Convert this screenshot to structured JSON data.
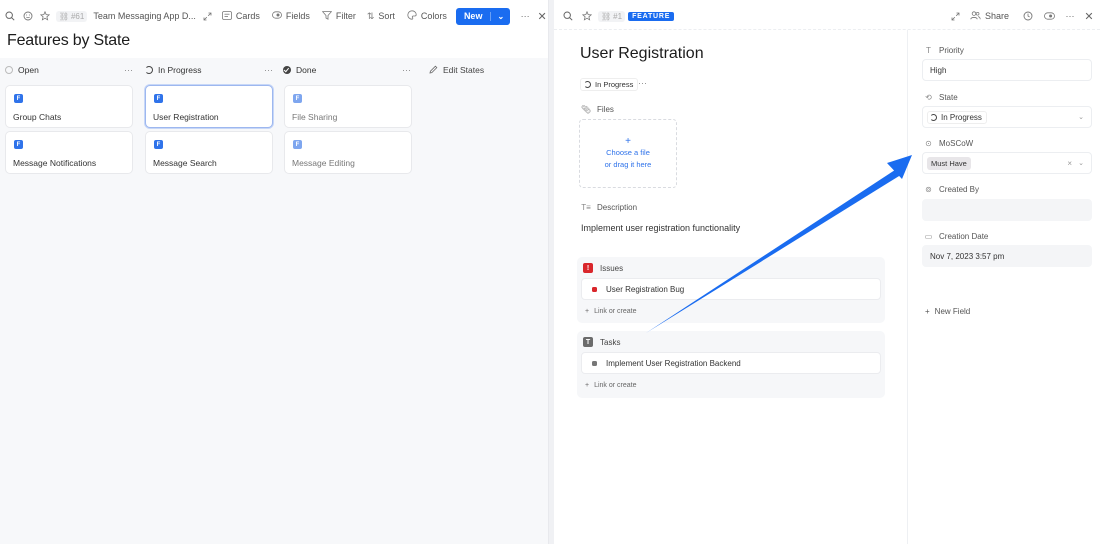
{
  "left_panel": {
    "toolbar": {
      "search_icon": "search-icon",
      "emoji_icon": "smiley-icon",
      "star_icon": "star-icon",
      "id_label": "#61",
      "breadcrumb": "Team Messaging App D...",
      "expand_icon": "expand-icon",
      "cards_label": "Cards",
      "fields_label": "Fields",
      "filter_label": "Filter",
      "sort_label": "Sort",
      "colors_label": "Colors",
      "new_label": "New",
      "more_icon": "more-icon",
      "close_icon": "close-icon"
    },
    "title": "Features by State",
    "columns": [
      {
        "name": "Open",
        "state": "open",
        "cards": [
          {
            "title": "Group Chats"
          },
          {
            "title": "Message Notifications"
          }
        ]
      },
      {
        "name": "In Progress",
        "state": "in-progress",
        "cards": [
          {
            "title": "User Registration",
            "selected": true
          },
          {
            "title": "Message Search"
          }
        ]
      },
      {
        "name": "Done",
        "state": "done",
        "cards": [
          {
            "title": "File Sharing"
          },
          {
            "title": "Message Editing"
          }
        ]
      }
    ],
    "card_badge": "F",
    "column_more": "···",
    "edit_states_label": "Edit States"
  },
  "right_panel": {
    "toolbar": {
      "id_label": "#1",
      "type_tag": "FEATURE",
      "share_label": "Share"
    },
    "title": "User Registration",
    "state": "In Progress",
    "more": "···",
    "files_label": "Files",
    "dropzone": {
      "plus": "+",
      "line1": "Choose a file",
      "line2": "or drag it here"
    },
    "description_label": "Description",
    "description": "Implement user registration functionality",
    "issues": {
      "badge": "!",
      "label": "Issues",
      "items": [
        "User Registration Bug"
      ],
      "link_label": "Link or create"
    },
    "tasks": {
      "badge": "T",
      "label": "Tasks",
      "items": [
        "Implement User Registration Backend"
      ],
      "link_label": "Link or create"
    },
    "properties": {
      "priority": {
        "label": "Priority",
        "value": "High"
      },
      "state": {
        "label": "State",
        "value": "In Progress"
      },
      "moscow": {
        "label": "MoSCoW",
        "value": "Must Have"
      },
      "created_by": {
        "label": "Created By",
        "value": ""
      },
      "creation_date": {
        "label": "Creation Date",
        "value": "Nov 7, 2023 3:57 pm"
      },
      "new_field_label": "New Field"
    }
  },
  "colors": {
    "accent": "#1a6cf0",
    "issue_red": "#d9262b",
    "task_gray": "#6b6b6b",
    "annotation_arrow": "#1a6cf0"
  }
}
